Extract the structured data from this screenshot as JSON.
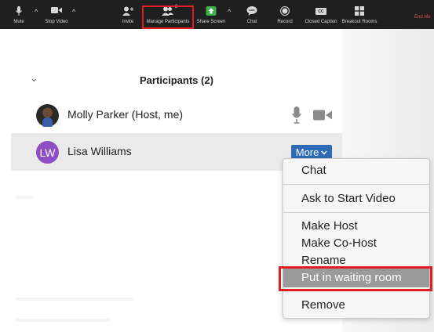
{
  "toolbar": {
    "mute_label": "Mute",
    "stop_video_label": "Stop Video",
    "invite_label": "Invite",
    "manage_participants_label": "Manage Participants",
    "participant_count": "2",
    "share_screen_label": "Share Screen",
    "chat_label": "Chat",
    "record_label": "Record",
    "closed_caption_label": "Closed Caption",
    "cc_badge": "CC",
    "breakout_rooms_label": "Breakout Rooms",
    "end_label": "End Me"
  },
  "panel": {
    "title": "Participants (2)",
    "participants": [
      {
        "name": "Molly Parker (Host, me)"
      },
      {
        "name": "Lisa Williams",
        "initials": "LW",
        "more_label": "More"
      }
    ]
  },
  "menu": {
    "items": [
      "Chat",
      "Ask to Start Video",
      "Make Host",
      "Make Co-Host",
      "Rename",
      "Put in waiting room",
      "Remove"
    ]
  },
  "colors": {
    "toolbar_bg": "#1f1f1f",
    "highlight_red": "#e02020",
    "more_button_blue": "#2d6bb8",
    "avatar_purple": "#8e4fc4",
    "share_green": "#3cb043",
    "selected_gray": "#9a9a9a"
  },
  "icons": [
    "microphone-icon",
    "video-camera-icon",
    "invite-icon",
    "participants-icon",
    "share-screen-icon",
    "chat-icon",
    "record-icon",
    "closed-caption-icon",
    "breakout-rooms-icon",
    "chevron-down-icon"
  ]
}
